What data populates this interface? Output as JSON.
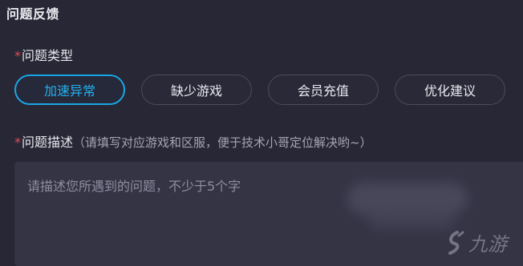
{
  "dialog": {
    "title": "问题反馈"
  },
  "problem_type": {
    "required_mark": "*",
    "label": "问题类型",
    "options": [
      {
        "label": "加速异常",
        "selected": true
      },
      {
        "label": "缺少游戏",
        "selected": false
      },
      {
        "label": "会员充值",
        "selected": false
      },
      {
        "label": "优化建议",
        "selected": false
      }
    ]
  },
  "problem_desc": {
    "required_mark": "*",
    "label": "问题描述",
    "hint": "（请填写对应游戏和区服，便于技术小哥定位解决哟~）",
    "placeholder": "请描述您所遇到的问题，不少于5个字"
  },
  "watermark": {
    "text": "九游",
    "icon": "jiuyou-logo-icon"
  },
  "colors": {
    "accent": "#1aa6e6",
    "required": "#e5484d",
    "background": "#282735"
  }
}
